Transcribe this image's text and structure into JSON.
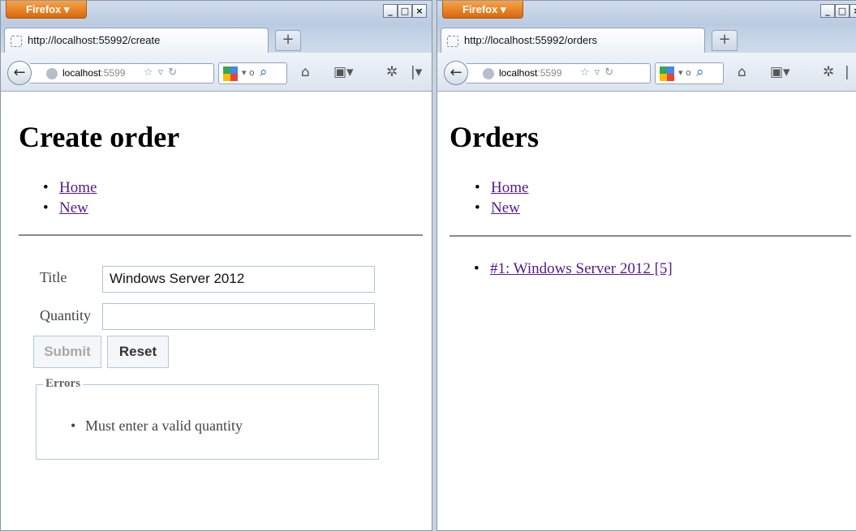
{
  "windows": [
    {
      "browser_button": "Firefox ▾",
      "tab_title": "http://localhost:55992/create",
      "url_host": "localhost",
      "url_rest": ":5599",
      "heading": "Create order",
      "nav_links": [
        "Home",
        "New"
      ],
      "form": {
        "title_label": "Title",
        "title_value": "Windows Server 2012",
        "quantity_label": "Quantity",
        "quantity_value": "",
        "submit_label": "Submit",
        "reset_label": "Reset"
      },
      "errors": {
        "legend": "Errors",
        "items": [
          "Must enter a valid quantity"
        ]
      }
    },
    {
      "browser_button": "Firefox ▾",
      "tab_title": "http://localhost:55992/orders",
      "url_host": "localhost",
      "url_rest": ":5599",
      "heading": "Orders",
      "nav_links": [
        "Home",
        "New"
      ],
      "orders": [
        "#1: Windows Server 2012 [5]"
      ]
    }
  ],
  "window_controls": [
    "_",
    "□",
    "×"
  ],
  "colors": {
    "link": "#551a8b",
    "firefox_orange": "#e8780f",
    "input_border": "#a7c7dc"
  }
}
